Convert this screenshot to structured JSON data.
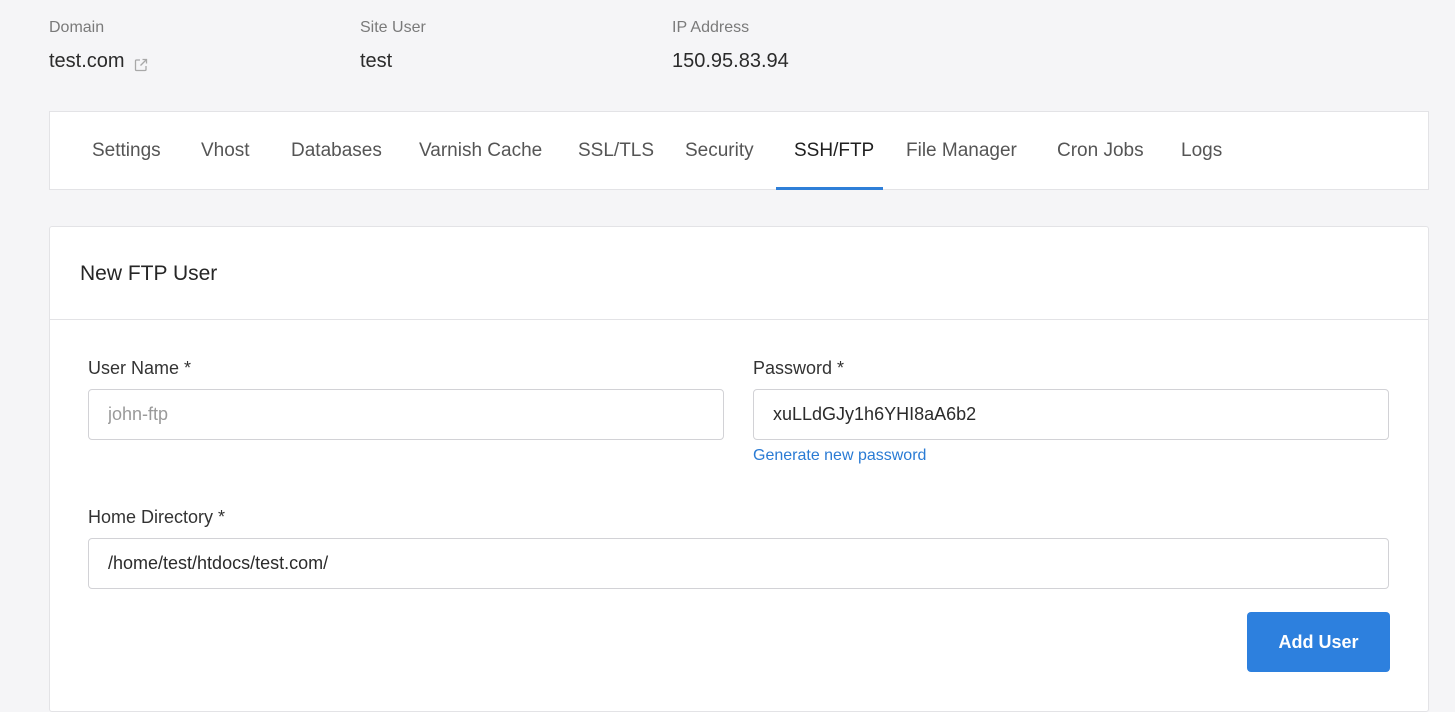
{
  "info": {
    "domain_label": "Domain",
    "domain_value": "test.com",
    "site_user_label": "Site User",
    "site_user_value": "test",
    "ip_label": "IP Address",
    "ip_value": "150.95.83.94",
    "external_link_icon": "external-link-icon"
  },
  "tabs": [
    {
      "label": "Settings",
      "active": false
    },
    {
      "label": "Vhost",
      "active": false
    },
    {
      "label": "Databases",
      "active": false
    },
    {
      "label": "Varnish Cache",
      "active": false
    },
    {
      "label": "SSL/TLS",
      "active": false
    },
    {
      "label": "Security",
      "active": false
    },
    {
      "label": "SSH/FTP",
      "active": true
    },
    {
      "label": "File Manager",
      "active": false
    },
    {
      "label": "Cron Jobs",
      "active": false
    },
    {
      "label": "Logs",
      "active": false
    }
  ],
  "form": {
    "title": "New FTP User",
    "username_label": "User Name *",
    "username_placeholder": "john-ftp",
    "username_value": "",
    "password_label": "Password *",
    "password_value": "xuLLdGJy1h6YHI8aA6b2",
    "generate_link": "Generate new password",
    "home_dir_label": "Home Directory *",
    "home_dir_value": "/home/test/htdocs/test.com/",
    "submit_label": "Add User"
  },
  "colors": {
    "accent": "#2d80de",
    "link": "#2a7bd4",
    "background": "#f5f5f7"
  }
}
